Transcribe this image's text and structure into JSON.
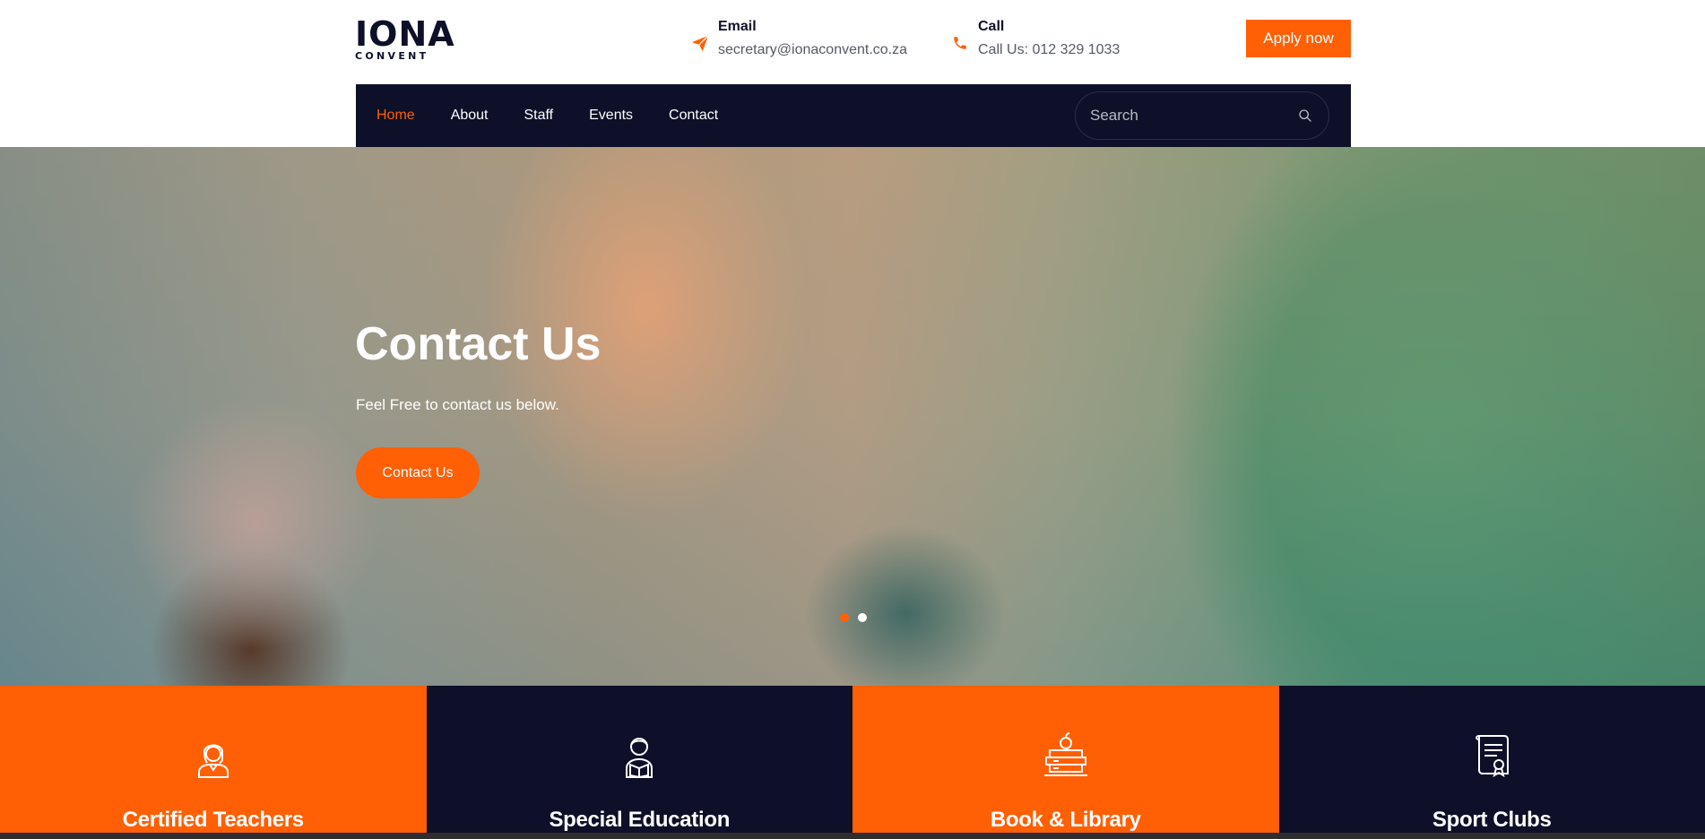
{
  "brand": {
    "name": "IONA",
    "subtitle": "CONVENT"
  },
  "header": {
    "email": {
      "title": "Email",
      "value": "secretary@ionaconvent.co.za",
      "icon": "paper-plane-icon"
    },
    "call": {
      "title": "Call",
      "value": "Call Us: 012 329 1033",
      "icon": "phone-icon"
    },
    "apply_label": "Apply now"
  },
  "nav": {
    "items": [
      {
        "label": "Home",
        "active": true
      },
      {
        "label": "About"
      },
      {
        "label": "Staff"
      },
      {
        "label": "Events"
      },
      {
        "label": "Contact"
      }
    ],
    "search_placeholder": "Search"
  },
  "hero": {
    "title": "Contact Us",
    "subtitle": "Feel Free to contact us below.",
    "button_label": "Contact Us",
    "slides": [
      {
        "active": true
      },
      {
        "active": false
      }
    ]
  },
  "features": [
    {
      "label": "Certified Teachers",
      "icon": "teacher-icon",
      "bg": "#ff5f05"
    },
    {
      "label": "Special Education",
      "icon": "student-reading-icon",
      "bg": "#0d1028"
    },
    {
      "label": "Book & Library",
      "icon": "books-apple-icon",
      "bg": "#ff5f05"
    },
    {
      "label": "Sport Clubs",
      "icon": "certificate-scroll-icon",
      "bg": "#0d1028"
    }
  ],
  "colors": {
    "accent": "#ff5f05",
    "navy": "#0d1028",
    "white": "#ffffff"
  }
}
